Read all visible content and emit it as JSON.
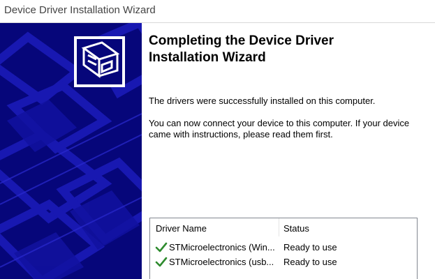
{
  "window": {
    "title": "Device Driver Installation Wizard"
  },
  "main": {
    "heading_line1": "Completing the Device Driver",
    "heading_line2": "Installation Wizard",
    "paragraph1": "The drivers were successfully installed on this computer.",
    "paragraph2_line1": "You can now connect your device to this computer. If your device",
    "paragraph2_line2": "came with instructions, please read them first."
  },
  "driver_list": {
    "columns": [
      "Driver Name",
      "Status"
    ],
    "rows": [
      {
        "name": "STMicroelectronics (Win...",
        "status": "Ready to use",
        "icon": "checkmark-icon"
      },
      {
        "name": "STMicroelectronics (usb...",
        "status": "Ready to use",
        "icon": "checkmark-icon"
      }
    ]
  },
  "colors": {
    "banner_dark": "#06067a",
    "banner_pattern": "#1a1ab8",
    "check_green": "#2e8b2e"
  }
}
